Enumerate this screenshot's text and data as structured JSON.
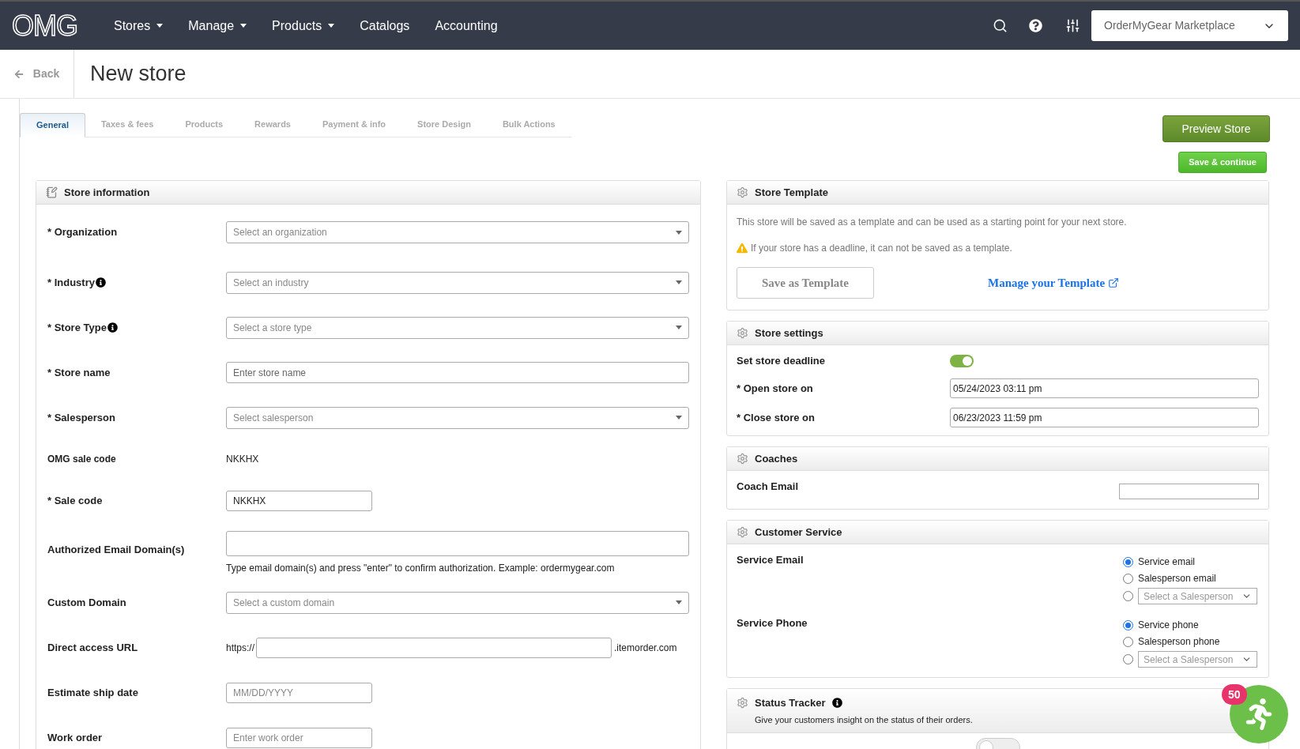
{
  "nav": {
    "logo": "OMG",
    "menu": [
      {
        "label": "Stores",
        "dropdown": true
      },
      {
        "label": "Manage",
        "dropdown": true
      },
      {
        "label": "Products",
        "dropdown": true
      },
      {
        "label": "Catalogs",
        "dropdown": false
      },
      {
        "label": "Accounting",
        "dropdown": false
      }
    ],
    "account": "OrderMyGear Marketplace"
  },
  "header": {
    "back": "Back",
    "title": "New store"
  },
  "tabs": [
    {
      "label": "General",
      "selected": true
    },
    {
      "label": "Taxes & fees",
      "selected": false
    },
    {
      "label": "Products",
      "selected": false
    },
    {
      "label": "Rewards",
      "selected": false
    },
    {
      "label": "Payment & info",
      "selected": false
    },
    {
      "label": "Store Design",
      "selected": false
    },
    {
      "label": "Bulk Actions",
      "selected": false
    }
  ],
  "actions": {
    "preview": "Preview Store",
    "save": "Save & continue"
  },
  "store_information": {
    "title": "Store information",
    "rows": [
      {
        "label": "* Organization",
        "kind": "select",
        "placeholder": "Select an organization",
        "info": false
      },
      {
        "label": "* Industry",
        "kind": "select",
        "placeholder": "Select an industry",
        "info": true
      },
      {
        "label": "* Store Type",
        "kind": "select",
        "placeholder": "Select a store type",
        "info": true
      },
      {
        "label": "* Store name",
        "kind": "text",
        "placeholder": "Enter store name",
        "info": false
      },
      {
        "label": "* Salesperson",
        "kind": "select",
        "placeholder": "Select salesperson",
        "info": false
      },
      {
        "label": "OMG sale code",
        "kind": "static",
        "value": "NKKHX",
        "info": false
      },
      {
        "label": "* Sale code",
        "kind": "short",
        "value": "NKKHX",
        "info": false
      },
      {
        "label": "Authorized Email Domain(s)",
        "kind": "text",
        "hint": "Type email domain(s) and press \"enter\" to confirm authorization. Example: ordermygear.com",
        "info": false
      },
      {
        "label": "Custom Domain",
        "kind": "select",
        "placeholder": "Select a custom domain",
        "info": false
      },
      {
        "label": "Direct access URL",
        "kind": "url",
        "prefix": "https://",
        "suffix": ".itemorder.com",
        "info": false
      },
      {
        "label": "Estimate ship date",
        "kind": "short",
        "placeholder": "MM/DD/YYYY",
        "info": false
      },
      {
        "label": "Work order",
        "kind": "short",
        "placeholder": "Enter work order",
        "info": false
      }
    ]
  },
  "store_template": {
    "title": "Store Template",
    "text": "This store will be saved as a template and can be used as a starting point for your next store.",
    "warning": "If your store has a deadline, it can not be saved as a template.",
    "save": "Save as Template",
    "manage": "Manage your Template"
  },
  "store_settings": {
    "title": "Store settings",
    "deadline": {
      "label": "Set store deadline",
      "on": true
    },
    "open": {
      "label": "* Open store on",
      "value": "05/24/2023 03:11 pm"
    },
    "close": {
      "label": "* Close store on",
      "value": "06/23/2023 11:59 pm"
    }
  },
  "coaches": {
    "title": "Coaches",
    "label": "Coach Email"
  },
  "customer_service": {
    "title": "Customer Service",
    "groups": [
      {
        "label": "Service Email",
        "options": [
          {
            "kind": "radio",
            "label": "Service email",
            "selected": true
          },
          {
            "kind": "radio",
            "label": "Salesperson email",
            "selected": false
          },
          {
            "kind": "select",
            "label": "Select a Salesperson",
            "selected": false
          }
        ]
      },
      {
        "label": "Service Phone",
        "options": [
          {
            "kind": "radio",
            "label": "Service phone",
            "selected": true
          },
          {
            "kind": "radio",
            "label": "Salesperson phone",
            "selected": false
          },
          {
            "kind": "select",
            "label": "Select a Salesperson",
            "selected": false
          }
        ]
      }
    ]
  },
  "status_tracker": {
    "title": "Status Tracker",
    "subtitle": "Give your customers insight on the status of their orders.",
    "on": false
  },
  "floating": {
    "badge": "50"
  }
}
